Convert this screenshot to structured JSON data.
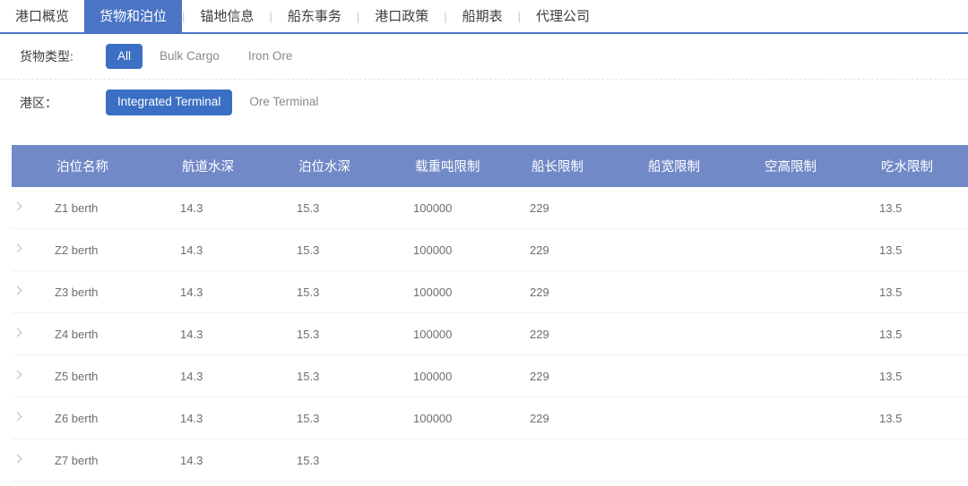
{
  "tabs": [
    {
      "label": "港口概览",
      "active": false
    },
    {
      "label": "货物和泊位",
      "active": true
    },
    {
      "label": "锚地信息",
      "active": false
    },
    {
      "label": "船东事务",
      "active": false
    },
    {
      "label": "港口政策",
      "active": false
    },
    {
      "label": "船期表",
      "active": false
    },
    {
      "label": "代理公司",
      "active": false
    }
  ],
  "tab_separator": "|",
  "filters": [
    {
      "label": "货物类型:",
      "options": [
        {
          "label": "All",
          "active": true
        },
        {
          "label": "Bulk Cargo",
          "active": false
        },
        {
          "label": "Iron Ore",
          "active": false
        }
      ]
    },
    {
      "label": "港区：",
      "options": [
        {
          "label": "Integrated Terminal",
          "active": true
        },
        {
          "label": "Ore Terminal",
          "active": false
        }
      ]
    }
  ],
  "table": {
    "columns": [
      "泊位名称",
      "航道水深",
      "泊位水深",
      "载重吨限制",
      "船长限制",
      "船宽限制",
      "空高限制",
      "吃水限制"
    ],
    "rows": [
      {
        "name": "Z1 berth",
        "channel_depth": "14.3",
        "berth_depth": "15.3",
        "dwt_limit": "100000",
        "loa_limit": "229",
        "beam_limit": "",
        "air_draft_limit": "",
        "draft_limit": "13.5"
      },
      {
        "name": "Z2 berth",
        "channel_depth": "14.3",
        "berth_depth": "15.3",
        "dwt_limit": "100000",
        "loa_limit": "229",
        "beam_limit": "",
        "air_draft_limit": "",
        "draft_limit": "13.5"
      },
      {
        "name": "Z3 berth",
        "channel_depth": "14.3",
        "berth_depth": "15.3",
        "dwt_limit": "100000",
        "loa_limit": "229",
        "beam_limit": "",
        "air_draft_limit": "",
        "draft_limit": "13.5"
      },
      {
        "name": "Z4 berth",
        "channel_depth": "14.3",
        "berth_depth": "15.3",
        "dwt_limit": "100000",
        "loa_limit": "229",
        "beam_limit": "",
        "air_draft_limit": "",
        "draft_limit": "13.5"
      },
      {
        "name": "Z5 berth",
        "channel_depth": "14.3",
        "berth_depth": "15.3",
        "dwt_limit": "100000",
        "loa_limit": "229",
        "beam_limit": "",
        "air_draft_limit": "",
        "draft_limit": "13.5"
      },
      {
        "name": "Z6 berth",
        "channel_depth": "14.3",
        "berth_depth": "15.3",
        "dwt_limit": "100000",
        "loa_limit": "229",
        "beam_limit": "",
        "air_draft_limit": "",
        "draft_limit": "13.5"
      },
      {
        "name": "Z7 berth",
        "channel_depth": "14.3",
        "berth_depth": "15.3",
        "dwt_limit": "",
        "loa_limit": "",
        "beam_limit": "",
        "air_draft_limit": "",
        "draft_limit": ""
      }
    ],
    "expand_icon": "chevron-right-icon"
  },
  "colors": {
    "tab_active_bg": "#4a74c4",
    "tab_underline": "#4a74c4",
    "chip_active_bg": "#3b6fc4",
    "table_header_bg": "#7289c8",
    "row_border": "#f2f2f2",
    "filter_divider": "#f0dede"
  }
}
